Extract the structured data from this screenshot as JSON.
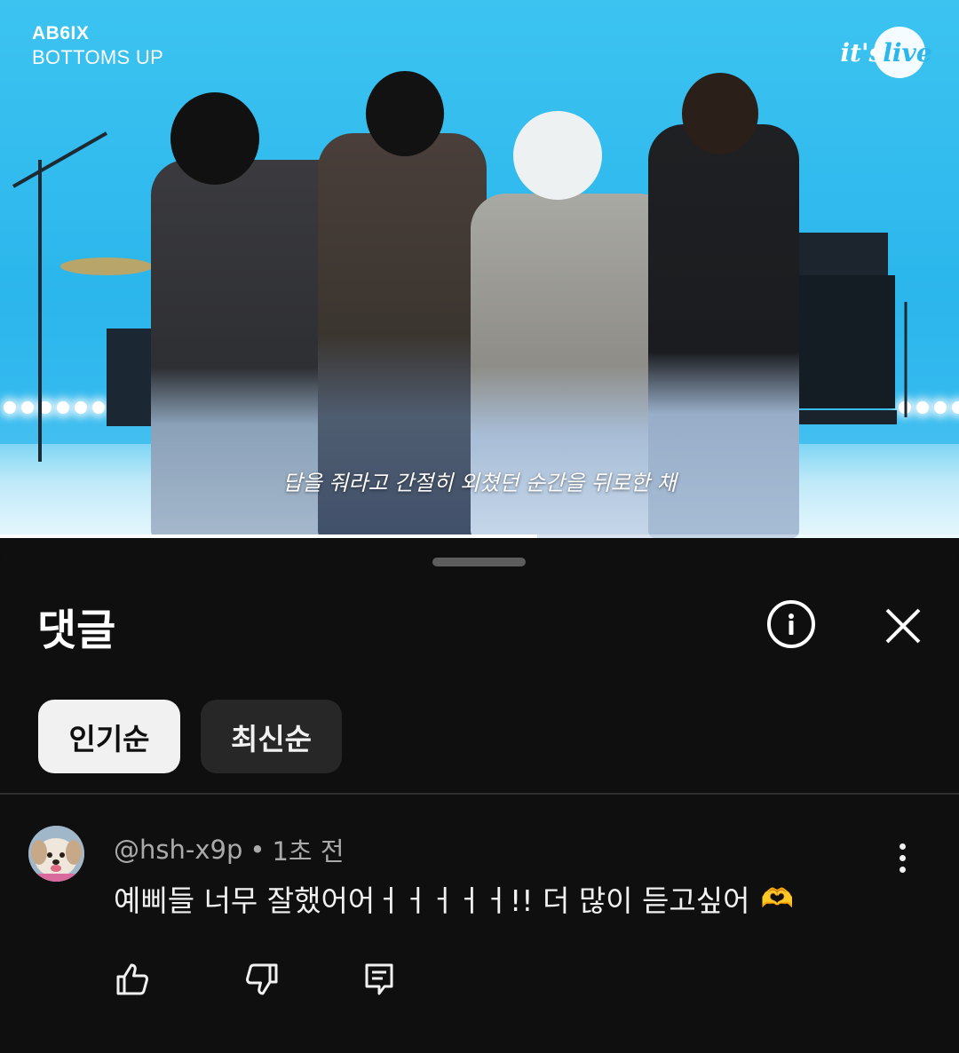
{
  "video": {
    "artist": "AB6IX",
    "song_title": "BOTTOMS UP",
    "channel_logo_icon": "its-live-logo",
    "logo_text_its": "it's",
    "logo_text_live": "live",
    "subtitle": "답을 줘라고 간절히 외쳤던 순간을 뒤로한 채",
    "progress_fraction": 0.56,
    "colors": {
      "stage_background": "#2bb6ec",
      "progress": "#ffffff"
    }
  },
  "comments_panel": {
    "title": "댓글",
    "info_icon": "info-icon",
    "close_icon": "close-icon",
    "sort_chips": [
      {
        "label": "인기순",
        "selected": true
      },
      {
        "label": "최신순",
        "selected": false
      }
    ],
    "comments": [
      {
        "author": "@hsh-x9p",
        "separator": "•",
        "time": "1초 전",
        "text": "예삐들 너무 잘했어어ㅓㅓㅓㅓㅓ!!  더 많이 듣고싶어",
        "emoji": "🫶",
        "avatar_icon": "dog-avatar",
        "actions": [
          "like-icon",
          "dislike-icon",
          "reply-icon"
        ],
        "menu_icon": "more-vert-icon"
      }
    ]
  },
  "colors": {
    "background": "#0f0f0f",
    "chip_selected_bg": "#f1f1f1",
    "chip_bg": "#272727",
    "meta_text": "#aaaaaa"
  }
}
